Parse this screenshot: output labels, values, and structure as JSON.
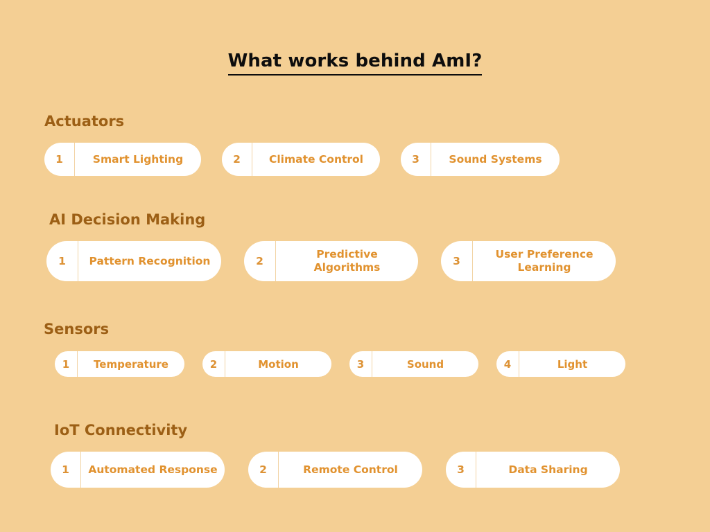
{
  "page": {
    "title": "What works behind AmI?",
    "background_color": "#f4cf94",
    "heading_color": "#9c5f15",
    "label_color": "#e1922f",
    "pill_color": "#ffffff",
    "title_color": "#0d0d0d"
  },
  "sections": [
    {
      "heading": "Actuators",
      "items": [
        {
          "number": "1",
          "label": "Smart Lighting"
        },
        {
          "number": "2",
          "label": "Climate Control"
        },
        {
          "number": "3",
          "label": "Sound Systems"
        }
      ]
    },
    {
      "heading": "AI Decision Making",
      "items": [
        {
          "number": "1",
          "label": "Pattern Recognition"
        },
        {
          "number": "2",
          "label": "Predictive Algorithms"
        },
        {
          "number": "3",
          "label": "User Preference Learning"
        }
      ]
    },
    {
      "heading": "Sensors",
      "items": [
        {
          "number": "1",
          "label": "Temperature"
        },
        {
          "number": "2",
          "label": "Motion"
        },
        {
          "number": "3",
          "label": "Sound"
        },
        {
          "number": "4",
          "label": "Light"
        }
      ]
    },
    {
      "heading": "IoT Connectivity",
      "items": [
        {
          "number": "1",
          "label": "Automated Response"
        },
        {
          "number": "2",
          "label": "Remote Control"
        },
        {
          "number": "3",
          "label": "Data Sharing"
        }
      ]
    }
  ]
}
